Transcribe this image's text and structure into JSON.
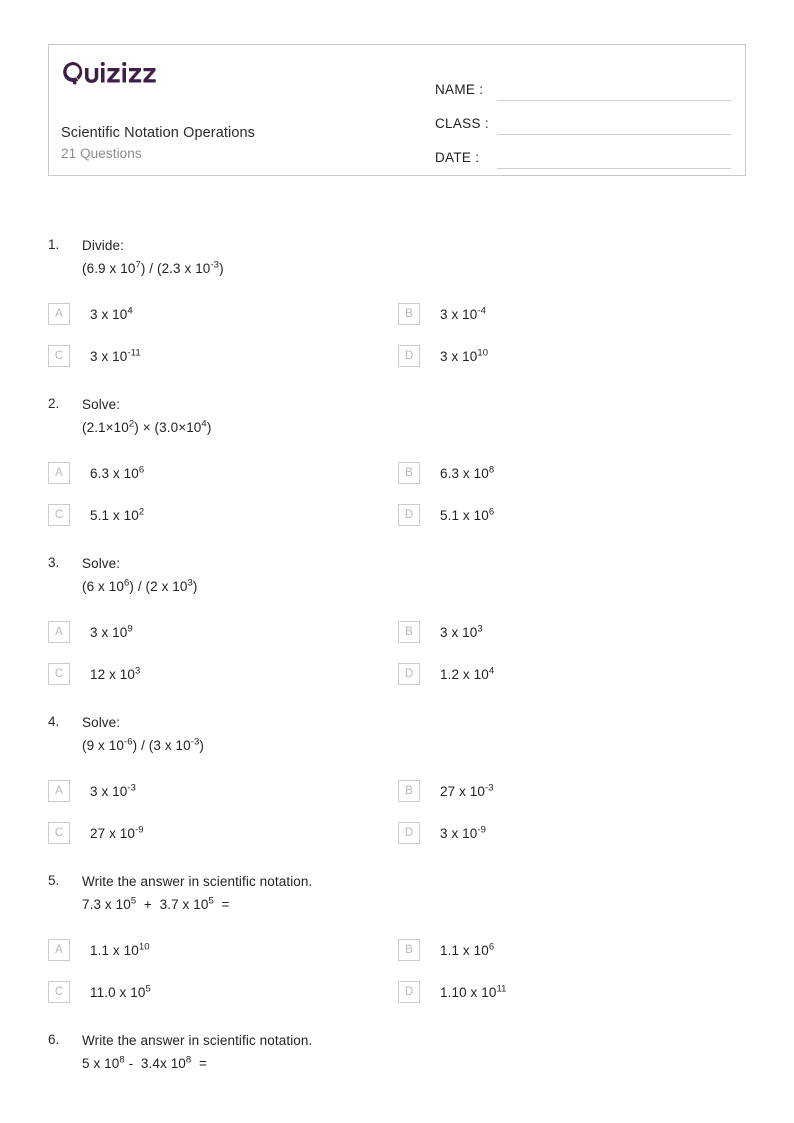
{
  "header": {
    "logo_text": "Quizizz",
    "logo_color": "#3d1f47",
    "title": "Scientific Notation Operations",
    "question_count": "21 Questions",
    "fields": [
      {
        "label": "NAME :",
        "value": ""
      },
      {
        "label": "CLASS :",
        "value": ""
      },
      {
        "label": "DATE  :",
        "value": ""
      }
    ]
  },
  "questions": [
    {
      "number": "1.",
      "prompt": "Divide:",
      "expression_parts": [
        {
          "t": "(6.9 x 10"
        },
        {
          "sup": "7"
        },
        {
          "t": ") / (2.3 x 10"
        },
        {
          "sup": "-3"
        },
        {
          "t": ")"
        }
      ],
      "options": [
        {
          "letter": "A",
          "parts": [
            {
              "t": "3 x 10"
            },
            {
              "sup": "4"
            }
          ]
        },
        {
          "letter": "B",
          "parts": [
            {
              "t": "3 x 10"
            },
            {
              "sup": "-4"
            }
          ]
        },
        {
          "letter": "C",
          "parts": [
            {
              "t": "3 x 10"
            },
            {
              "sup": "-11"
            }
          ]
        },
        {
          "letter": "D",
          "parts": [
            {
              "t": "3 x 10"
            },
            {
              "sup": "10"
            }
          ]
        }
      ]
    },
    {
      "number": "2.",
      "prompt": "Solve:",
      "expression_parts": [
        {
          "t": "(2.1×10"
        },
        {
          "sup": "2"
        },
        {
          "t": ") × (3.0×10"
        },
        {
          "sup": "4"
        },
        {
          "t": ")"
        }
      ],
      "options": [
        {
          "letter": "A",
          "parts": [
            {
              "t": "6.3 x 10"
            },
            {
              "sup": "6"
            }
          ]
        },
        {
          "letter": "B",
          "parts": [
            {
              "t": "6.3 x 10"
            },
            {
              "sup": "8"
            }
          ]
        },
        {
          "letter": "C",
          "parts": [
            {
              "t": "5.1 x 10"
            },
            {
              "sup": "2"
            }
          ]
        },
        {
          "letter": "D",
          "parts": [
            {
              "t": "5.1 x 10"
            },
            {
              "sup": "6"
            }
          ]
        }
      ]
    },
    {
      "number": "3.",
      "prompt": "Solve:",
      "expression_parts": [
        {
          "t": "(6 x 10"
        },
        {
          "sup": "6"
        },
        {
          "t": ") / (2 x 10"
        },
        {
          "sup": "3"
        },
        {
          "t": ")"
        }
      ],
      "options": [
        {
          "letter": "A",
          "parts": [
            {
              "t": "3 x 10"
            },
            {
              "sup": "9"
            }
          ]
        },
        {
          "letter": "B",
          "parts": [
            {
              "t": "3 x 10"
            },
            {
              "sup": "3"
            }
          ]
        },
        {
          "letter": "C",
          "parts": [
            {
              "t": "12 x 10"
            },
            {
              "sup": "3"
            }
          ]
        },
        {
          "letter": "D",
          "parts": [
            {
              "t": "1.2 x 10"
            },
            {
              "sup": "4"
            }
          ]
        }
      ]
    },
    {
      "number": "4.",
      "prompt": "Solve:",
      "expression_parts": [
        {
          "t": "(9 x 10"
        },
        {
          "sup": "-6"
        },
        {
          "t": ") / (3 x 10"
        },
        {
          "sup": "-3"
        },
        {
          "t": ")"
        }
      ],
      "options": [
        {
          "letter": "A",
          "parts": [
            {
              "t": "3 x 10"
            },
            {
              "sup": "-3"
            }
          ]
        },
        {
          "letter": "B",
          "parts": [
            {
              "t": "27 x 10"
            },
            {
              "sup": "-3"
            }
          ]
        },
        {
          "letter": "C",
          "parts": [
            {
              "t": "27 x 10"
            },
            {
              "sup": "-9"
            }
          ]
        },
        {
          "letter": "D",
          "parts": [
            {
              "t": "3 x 10"
            },
            {
              "sup": "-9"
            }
          ]
        }
      ]
    },
    {
      "number": "5.",
      "prompt": "Write the answer in scientific notation.",
      "expression_parts": [
        {
          "t": "7.3 x 10"
        },
        {
          "sup": "5"
        },
        {
          "t": "  +  3.7 x 10"
        },
        {
          "sup": "5"
        },
        {
          "t": "  ="
        }
      ],
      "options": [
        {
          "letter": "A",
          "parts": [
            {
              "t": "1.1 x 10"
            },
            {
              "sup": "10"
            }
          ]
        },
        {
          "letter": "B",
          "parts": [
            {
              "t": "1.1 x 10"
            },
            {
              "sup": "6"
            }
          ]
        },
        {
          "letter": "C",
          "parts": [
            {
              "t": "11.0 x 10"
            },
            {
              "sup": "5"
            }
          ]
        },
        {
          "letter": "D",
          "parts": [
            {
              "t": "1.10 x 10"
            },
            {
              "sup": "11"
            }
          ]
        }
      ]
    },
    {
      "number": "6.",
      "prompt": "Write the answer in scientific notation.",
      "expression_parts": [
        {
          "t": "5 x 10"
        },
        {
          "sup": "8"
        },
        {
          "t": " -  3.4x 10"
        },
        {
          "sup": "8"
        },
        {
          "t": "  ="
        }
      ],
      "options": []
    }
  ]
}
